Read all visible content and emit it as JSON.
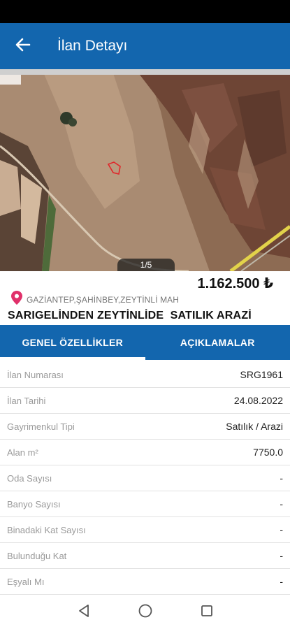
{
  "header": {
    "title": "İlan Detayı",
    "back_icon": "arrow-left-icon"
  },
  "gallery": {
    "page_indicator": "1/5"
  },
  "listing": {
    "price": "1.162.500 ₺",
    "location_icon": "map-pin-icon",
    "location": "GAZİANTEP,ŞAHİNBEY,ZEYTİNLİ MAH",
    "title": "SARIGELİNDEN ZEYTİNLİDE  SATILIK ARAZİ"
  },
  "tabs": [
    {
      "label": "GENEL ÖZELLİKLER",
      "active": true
    },
    {
      "label": "AÇIKLAMALAR",
      "active": false
    }
  ],
  "properties": [
    {
      "label": "İlan Numarası",
      "value": "SRG1961"
    },
    {
      "label": "İlan Tarihi",
      "value": "24.08.2022"
    },
    {
      "label": "Gayrimenkul Tipi",
      "value": "Satılık / Arazi"
    },
    {
      "label": "Alan m²",
      "value": "7750.0"
    },
    {
      "label": "Oda Sayısı",
      "value": "-"
    },
    {
      "label": "Banyo Sayısı",
      "value": "-"
    },
    {
      "label": "Binadaki Kat Sayısı",
      "value": "-"
    },
    {
      "label": "Bulunduğu Kat",
      "value": "-"
    },
    {
      "label": "Eşyalı Mı",
      "value": "-"
    }
  ],
  "colors": {
    "primary": "#1366ae",
    "pin": "#e0306a"
  },
  "system_nav": {
    "icons": [
      "back-triangle-icon",
      "home-circle-icon",
      "recents-square-icon"
    ]
  }
}
